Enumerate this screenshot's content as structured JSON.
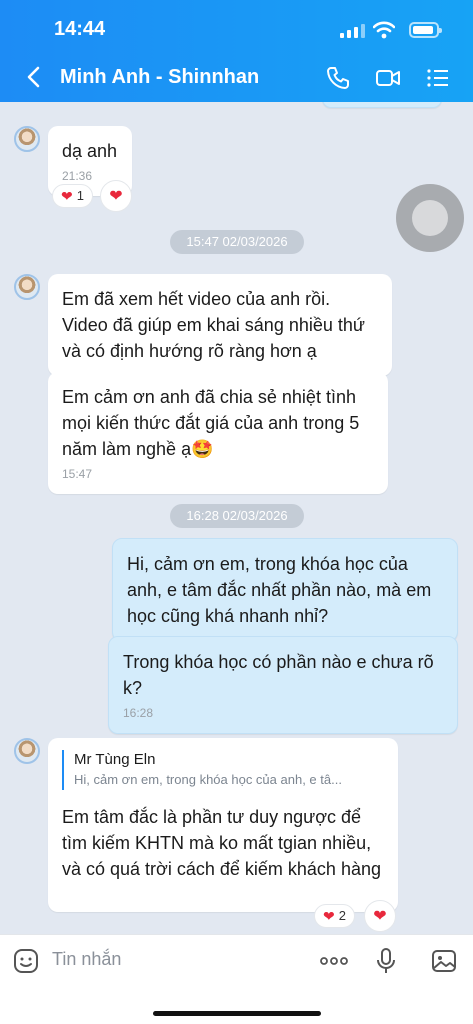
{
  "status": {
    "time": "14:44"
  },
  "header": {
    "title": "Minh Anh - Shinnhan"
  },
  "dates": {
    "d1": "15:47 02/03/2026",
    "d2": "16:28 02/03/2026"
  },
  "messages": {
    "m1": {
      "text": "dạ anh",
      "time": "21:36",
      "react_count": "1"
    },
    "m2": {
      "text": "Em đã xem hết video của anh rồi. Video đã giúp em khai sáng nhiều thứ và có định hướng rõ ràng hơn ạ"
    },
    "m3": {
      "text": "Em cảm ơn anh đã chia sẻ nhiệt tình mọi kiến thức đắt giá của anh trong 5 năm làm nghề ạ",
      "emoji": "🤩",
      "time": "15:47"
    },
    "m4": {
      "text": "Hi, cảm ơn em, trong khóa học của anh, e tâm đắc nhất phần nào, mà em học cũng khá nhanh nhỉ?"
    },
    "m5": {
      "text": "Trong khóa học có phần nào e chưa rõ k?",
      "time": "16:28"
    },
    "m6": {
      "quote_name": "Mr Tùng Eln",
      "quote_text": "Hi, cảm ơn em, trong khóa học của anh, e tâ...",
      "text": "Em tâm đắc là phần tư duy ngược để tìm kiếm KHTN mà ko mất tgian nhiều, và có quá trời cách để kiếm khách hàng",
      "react_count": "2"
    }
  },
  "input": {
    "placeholder": "Tin nhắn"
  },
  "icons": [
    "back-icon",
    "phone-icon",
    "video-icon",
    "menu-icon",
    "sticker-icon",
    "more-icon",
    "microphone-icon",
    "image-icon",
    "heart-icon"
  ],
  "colors": {
    "header": "#1d8cf5",
    "sent_bubble": "#d4ecfb",
    "background": "#e2e8f1",
    "heart": "#e8283c"
  }
}
